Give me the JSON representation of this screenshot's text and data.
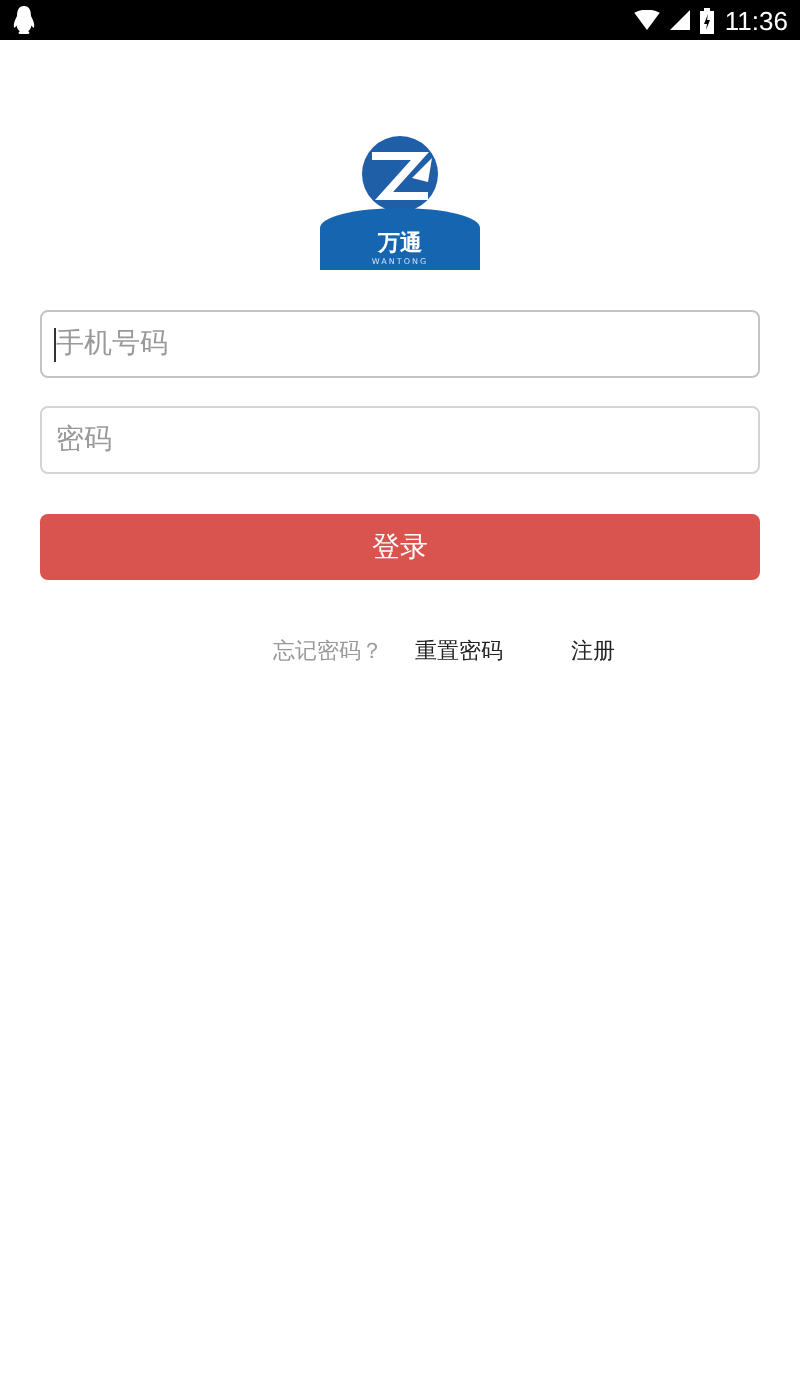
{
  "status_bar": {
    "time": "11:36"
  },
  "logo": {
    "name": "万通",
    "subtitle": "WANTONG"
  },
  "fields": [
    {
      "placeholder": "手机号码",
      "focused": true
    },
    {
      "placeholder": "密码",
      "focused": false
    }
  ],
  "login_button": "登录",
  "links": [
    {
      "label": "忘记密码？",
      "kind": "hint"
    },
    {
      "label": "重置密码",
      "kind": "link"
    },
    {
      "label": "注册",
      "kind": "link"
    }
  ]
}
